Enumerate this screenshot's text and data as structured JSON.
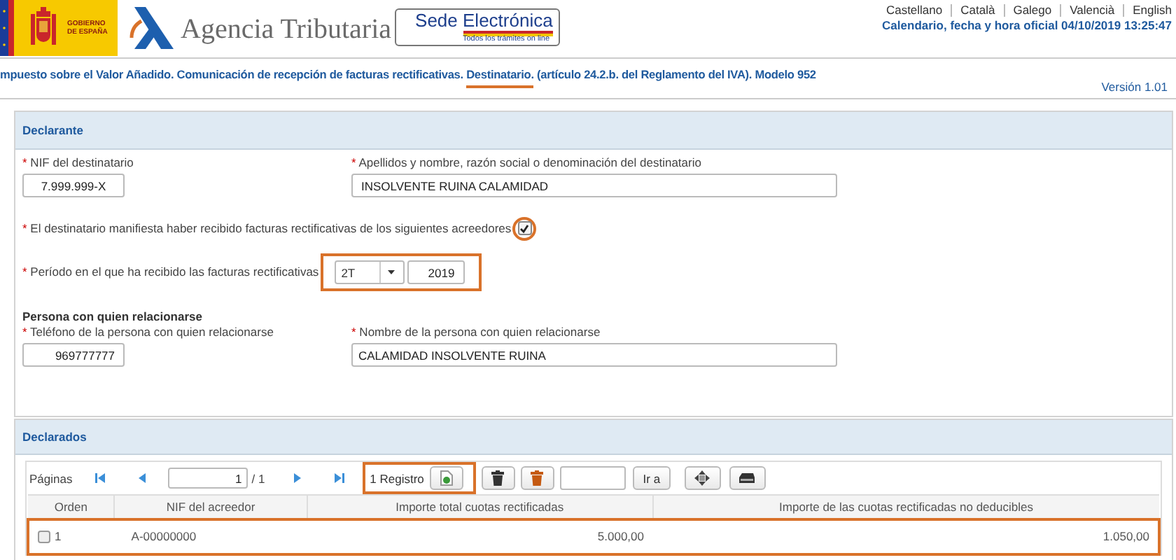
{
  "header": {
    "government": [
      "GOBIERNO",
      "DE ESPAÑA"
    ],
    "agency": "Agencia Tributaria",
    "sede": {
      "title": "Sede",
      "title_emphasis": "Electrónica",
      "tagline": "Todos los trámites on line"
    },
    "languages": [
      "Castellano",
      "Català",
      "Galego",
      "Valencià",
      "English"
    ],
    "official_time": "Calendario, fecha y hora oficial 04/10/2019 13:25:47"
  },
  "title": {
    "parts": [
      {
        "text": "mpuesto sobre el Valor Añadido. Comunicación de recepción de facturas rectificativas.",
        "highlighted": false
      },
      {
        "text": "Destinatario.",
        "highlighted": true
      },
      {
        "text": "(artículo 24.2.b. del Reglamento del IVA). Modelo 952",
        "highlighted": false
      }
    ],
    "version": "Versión 1.01"
  },
  "declarante": {
    "title": "Declarante",
    "nif": {
      "label": "* NIF del destinatario",
      "value": "7.999.999-X"
    },
    "nombre": {
      "label": "* Apellidos y nombre, razón social o denominación del destinatario",
      "value": "INSOLVENTE RUINA CALAMIDAD"
    },
    "acreedores": {
      "label": "* El destinatario manifiesta haber recibido facturas rectificativas de los siguientes acreedores",
      "checked": true,
      "highlighted": true
    },
    "periodo": {
      "label": "* Período en el que ha recibido las facturas rectificativas",
      "period": "2T",
      "year": "2019",
      "highlighted": true
    },
    "contact_heading": "Persona con quien relacionarse",
    "telefono": {
      "label": "* Teléfono de la persona con quien relacionarse",
      "value": "969777777"
    },
    "contacto": {
      "label": "* Nombre de la persona con quien relacionarse",
      "value": "CALAMIDAD INSOLVENTE RUINA"
    }
  },
  "declarados": {
    "title": "Declarados",
    "pager": {
      "label": "Páginas",
      "page": "1",
      "total": "/ 1"
    },
    "records": {
      "text": "1 Registro",
      "highlighted": true
    },
    "goto": "Ir a",
    "columns": [
      "Orden",
      "NIF del acreedor",
      "Importe total cuotas rectificadas",
      "Importe de las cuotas rectificadas no deducibles"
    ],
    "rows": [
      {
        "selected": false,
        "highlighted": true,
        "orden": "1",
        "nif": "A-00000000",
        "importe": "5.000,00",
        "no_deducible": "1.050,00"
      }
    ]
  }
}
